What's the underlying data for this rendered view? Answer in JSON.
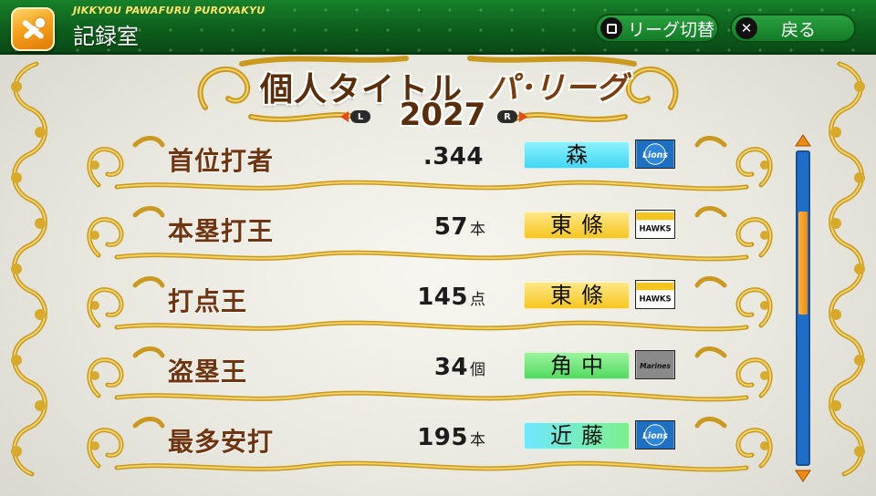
{
  "header": {
    "subtitle": "JIKKYOU PAWAFURU PUROYAKYU",
    "title": "記録室",
    "league_switch_label": "リーグ切替",
    "back_label": "戻る",
    "app_icon": "bat-and-ball-icon"
  },
  "banner": {
    "title": "個人タイトル",
    "league": "パ･リーグ",
    "year": "2027",
    "prev_key": "L",
    "next_key": "R"
  },
  "colors": {
    "header_green": "#0d5f1c",
    "category_brown": "#6e3510",
    "gold_frame": "#d8aa2c",
    "scroll_blue": "#1f6fc9",
    "scroll_thumb": "#f08a10"
  },
  "scroll": {
    "thumb_start_fraction": 0.19,
    "thumb_size_fraction": 0.33
  },
  "titles": [
    {
      "category": "首位打者",
      "value": ".344",
      "unit": "",
      "player": "森",
      "player_color": "cyan",
      "team_logo": "lions-logo",
      "team_text": "Lions"
    },
    {
      "category": "本塁打王",
      "value": "57",
      "unit": "本",
      "player": "東條",
      "player_color": "yellow",
      "team_logo": "hawks-logo",
      "team_text": "HAWKS"
    },
    {
      "category": "打点王",
      "value": "145",
      "unit": "点",
      "player": "東條",
      "player_color": "yellow",
      "team_logo": "hawks-logo",
      "team_text": "HAWKS"
    },
    {
      "category": "盗塁王",
      "value": "34",
      "unit": "個",
      "player": "角中",
      "player_color": "green",
      "team_logo": "marines-logo",
      "team_text": "Marines"
    },
    {
      "category": "最多安打",
      "value": "195",
      "unit": "本",
      "player": "近藤",
      "player_color": "cyan-green",
      "team_logo": "fighters-logo",
      "team_text": "Lions"
    }
  ]
}
